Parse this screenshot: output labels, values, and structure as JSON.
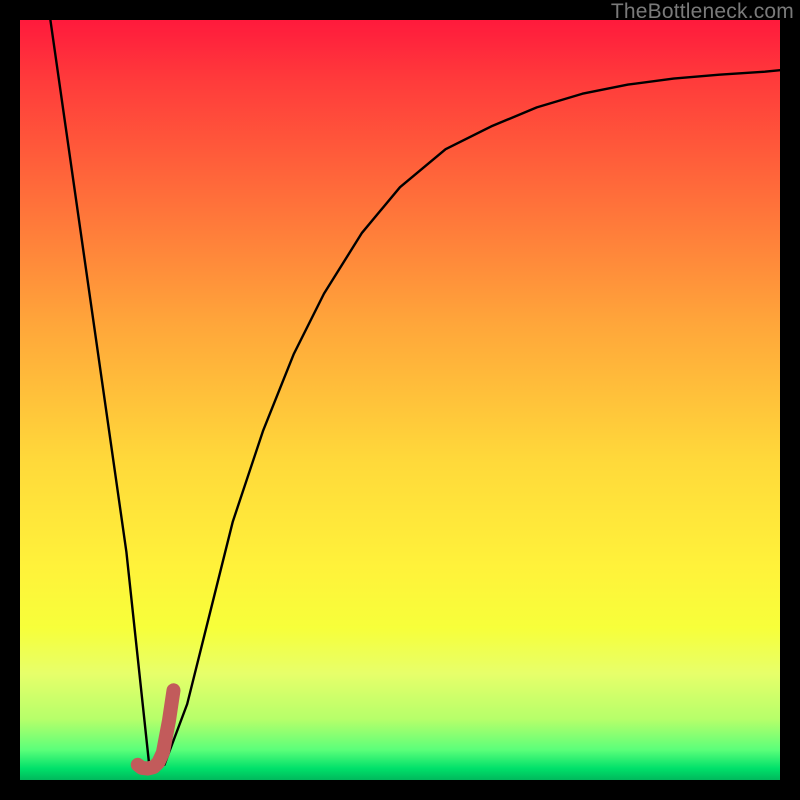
{
  "watermark": "TheBottleneck.com",
  "chart_data": {
    "type": "line",
    "title": "",
    "xlabel": "",
    "ylabel": "",
    "xlim": [
      0,
      100
    ],
    "ylim": [
      0,
      100
    ],
    "grid": false,
    "legend": false,
    "series": [
      {
        "name": "main-curve",
        "color": "#000000",
        "x": [
          4,
          6,
          8,
          10,
          12,
          14,
          15.5,
          17,
          19,
          22,
          25,
          28,
          32,
          36,
          40,
          45,
          50,
          56,
          62,
          68,
          74,
          80,
          86,
          92,
          98,
          100
        ],
        "y": [
          100,
          86,
          72,
          58,
          44,
          30,
          16,
          2,
          2,
          10,
          22,
          34,
          46,
          56,
          64,
          72,
          78,
          83,
          86,
          88.5,
          90.3,
          91.5,
          92.3,
          92.8,
          93.2,
          93.4
        ]
      },
      {
        "name": "accent-segment",
        "color": "#c25b5b",
        "x": [
          15.5,
          16,
          16.8,
          17.6,
          18.2,
          18.8,
          19.6,
          20.2
        ],
        "y": [
          2,
          1.6,
          1.5,
          1.7,
          2.3,
          3.6,
          7.8,
          11.8
        ]
      }
    ],
    "background": {
      "type": "vertical-gradient",
      "stops": [
        {
          "pos": 0.0,
          "color": "#ff1a3c"
        },
        {
          "pos": 0.5,
          "color": "#ffd93a"
        },
        {
          "pos": 0.82,
          "color": "#f7ff3a"
        },
        {
          "pos": 1.0,
          "color": "#00b85c"
        }
      ]
    }
  }
}
